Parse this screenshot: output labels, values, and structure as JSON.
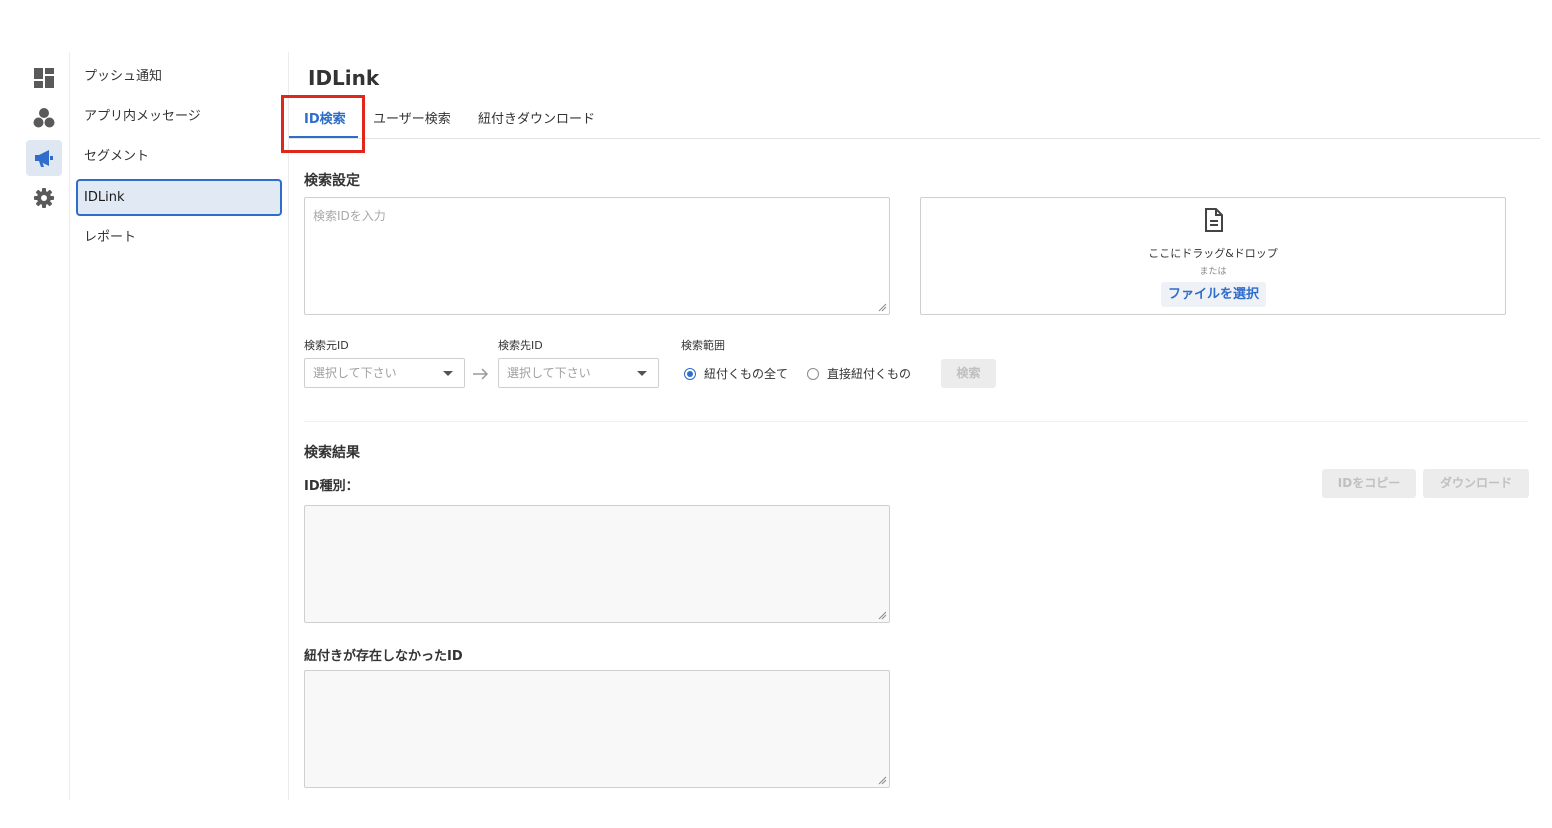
{
  "rail": {
    "items": [
      {
        "icon": "dashboard-icon"
      },
      {
        "icon": "segments-icon"
      },
      {
        "icon": "megaphone-icon",
        "active": true
      },
      {
        "icon": "gear-icon"
      }
    ]
  },
  "subnav": {
    "items": [
      {
        "label": "プッシュ通知"
      },
      {
        "label": "アプリ内メッセージ"
      },
      {
        "label": "セグメント"
      },
      {
        "label": "IDLink",
        "active": true
      },
      {
        "label": "レポート"
      }
    ]
  },
  "page": {
    "title": "IDLink"
  },
  "tabs": [
    {
      "label": "ID検索",
      "active": true
    },
    {
      "label": "ユーザー検索"
    },
    {
      "label": "紐付きダウンロード"
    }
  ],
  "search_settings": {
    "title": "検索設定",
    "input_placeholder": "検索IDを入力",
    "dropzone": {
      "text": "ここにドラッグ&ドロップ",
      "or_text": "または",
      "button_label": "ファイルを選択"
    },
    "source_id": {
      "label": "検索元ID",
      "placeholder": "選択して下さい"
    },
    "target_id": {
      "label": "検索先ID",
      "placeholder": "選択して下さい"
    },
    "scope": {
      "label": "検索範囲",
      "options": [
        {
          "label": "紐付くもの全て",
          "selected": true
        },
        {
          "label": "直接紐付くもの",
          "selected": false
        }
      ]
    },
    "search_button": "検索"
  },
  "results": {
    "title": "検索結果",
    "id_type_label": "ID種別：",
    "copy_button": "IDをコピー",
    "download_button": "ダウンロード",
    "unlinked_label": "紐付きが存在しなかったID"
  },
  "colors": {
    "accent": "#2f6dcb",
    "highlight": "#e0271c"
  }
}
